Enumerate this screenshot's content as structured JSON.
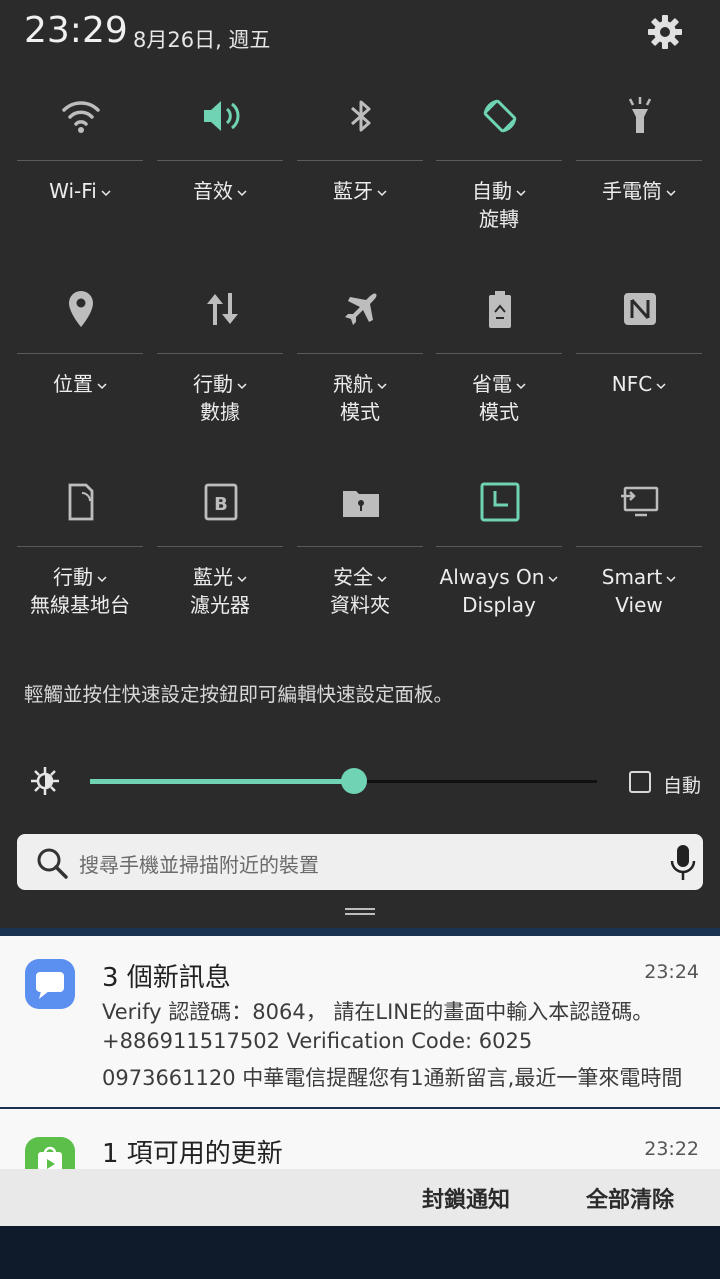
{
  "status_bar": {
    "time": "23:29",
    "date": "8月26日, 週五",
    "settings_icon": "gear-icon"
  },
  "accent_color": "#6fd3b4",
  "tiles": [
    {
      "label": "Wi-Fi",
      "icon": "wifi-icon",
      "active": false,
      "chevron": true
    },
    {
      "label": "音效",
      "icon": "volume-icon",
      "active": true,
      "chevron": true
    },
    {
      "label": "藍牙",
      "icon": "bluetooth-icon",
      "active": false,
      "chevron": true
    },
    {
      "label": "自動\n旋轉",
      "icon": "auto-rotate-icon",
      "active": true,
      "chevron": true
    },
    {
      "label": "手電筒",
      "icon": "flashlight-icon",
      "active": false,
      "chevron": true
    },
    {
      "label": "位置",
      "icon": "location-icon",
      "active": false,
      "chevron": true
    },
    {
      "label": "行動\n數據",
      "icon": "mobile-data-icon",
      "active": false,
      "chevron": true
    },
    {
      "label": "飛航\n模式",
      "icon": "airplane-icon",
      "active": false,
      "chevron": true
    },
    {
      "label": "省電\n模式",
      "icon": "power-saving-icon",
      "active": false,
      "chevron": true
    },
    {
      "label": "NFC",
      "icon": "nfc-icon",
      "active": false,
      "chevron": true
    },
    {
      "label": "行動\n無線基地台",
      "icon": "hotspot-icon",
      "active": false,
      "chevron": true
    },
    {
      "label": "藍光\n濾光器",
      "icon": "blue-light-filter-icon",
      "active": false,
      "chevron": true
    },
    {
      "label": "安全\n資料夾",
      "icon": "secure-folder-icon",
      "active": false,
      "chevron": true
    },
    {
      "label": "Always On\nDisplay",
      "icon": "always-on-display-icon",
      "active": true,
      "chevron": true
    },
    {
      "label": "Smart\nView",
      "icon": "smart-view-icon",
      "active": false,
      "chevron": true
    }
  ],
  "hint": "輕觸並按住快速設定按鈕即可編輯快速設定面板。",
  "brightness": {
    "level": 0.52,
    "auto_label": "自動",
    "auto_checked": false
  },
  "search": {
    "placeholder": "搜尋手機並掃描附近的裝置"
  },
  "notifications": [
    {
      "app_icon": "messages-icon",
      "title": "3 個新訊息",
      "time": "23:24",
      "lines": [
        "Verify  認證碼：8064， 請在LINE的畫面中輸入本認證碼。",
        "+886911517502  Verification Code: 6025",
        "0973661120  中華電信提醒您有1通新留言,最近一筆來電時間"
      ]
    },
    {
      "app_icon": "store-update-icon",
      "title": "1 項可用的更新",
      "time": "23:22"
    }
  ],
  "actions": {
    "block": "封鎖通知",
    "clear_all": "全部清除"
  }
}
